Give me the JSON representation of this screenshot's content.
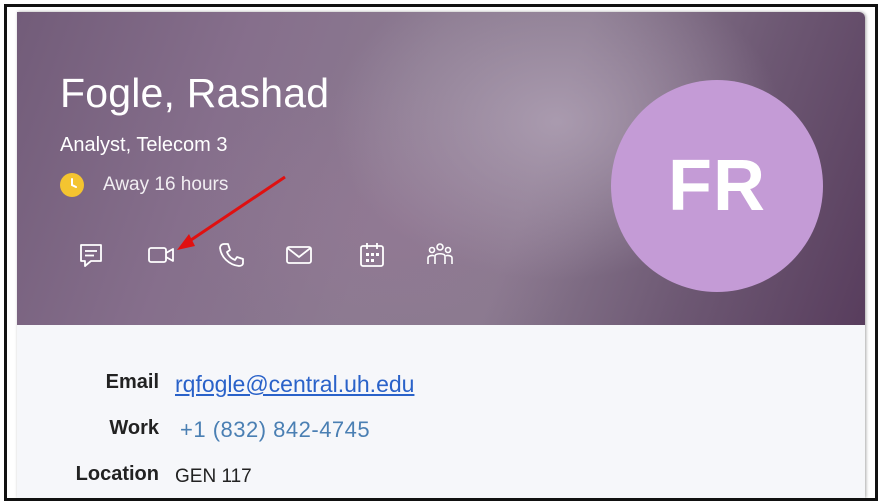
{
  "contact": {
    "name": "Fogle, Rashad",
    "title": "Analyst, Telecom 3",
    "status": "Away 16 hours",
    "initials": "FR"
  },
  "actions": [
    {
      "name": "chat",
      "icon": "chat-icon"
    },
    {
      "name": "video-call",
      "icon": "video-camera-icon"
    },
    {
      "name": "call",
      "icon": "phone-icon"
    },
    {
      "name": "email",
      "icon": "envelope-icon"
    },
    {
      "name": "meeting",
      "icon": "calendar-icon"
    },
    {
      "name": "organization",
      "icon": "people-icon"
    }
  ],
  "details": {
    "email_label": "Email",
    "email_value": "rqfogle@central.uh.edu",
    "work_label": "Work",
    "work_value": "+1 (832) 842-4745",
    "location_label": "Location",
    "location_value": "GEN 117"
  },
  "colors": {
    "header": "#866f8c",
    "avatar": "#c49bd6",
    "status_away": "#f4c430",
    "link": "#2a62c9",
    "annotation_arrow": "#e01010"
  }
}
